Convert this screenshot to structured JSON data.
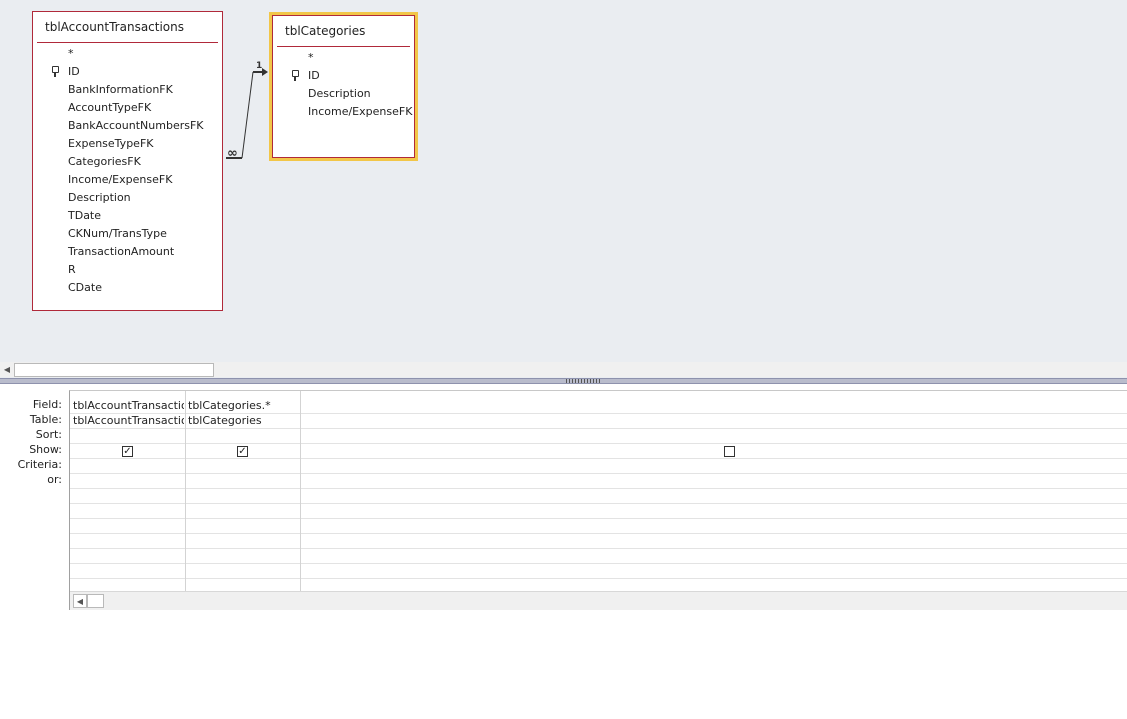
{
  "tables": [
    {
      "title": "tblAccountTransactions",
      "fields": [
        "*",
        "ID",
        "BankInformationFK",
        "AccountTypeFK",
        "BankAccountNumbersFK",
        "ExpenseTypeFK",
        "CategoriesFK",
        "Income/ExpenseFK",
        "Description",
        "TDate",
        "CKNum/TransType",
        "TransactionAmount",
        "R",
        "CDate"
      ],
      "key_field": "ID"
    },
    {
      "title": "tblCategories",
      "fields": [
        "*",
        "ID",
        "Description",
        "Income/ExpenseFK"
      ],
      "key_field": "ID"
    }
  ],
  "relationship": {
    "one_label": "1",
    "many_label": "∞"
  },
  "grid": {
    "row_labels": [
      "Field:",
      "Table:",
      "Sort:",
      "Show:",
      "Criteria:",
      "or:"
    ],
    "columns": [
      {
        "field": "tblAccountTransactio",
        "table": "tblAccountTransactio",
        "show": true
      },
      {
        "field": "tblCategories.*",
        "table": "tblCategories",
        "show": true
      },
      {
        "field": "",
        "table": "",
        "show": false
      }
    ]
  },
  "icons": {
    "key": "key-icon",
    "check": "check-icon",
    "scroll_left": "scroll-left-arrow-icon"
  }
}
